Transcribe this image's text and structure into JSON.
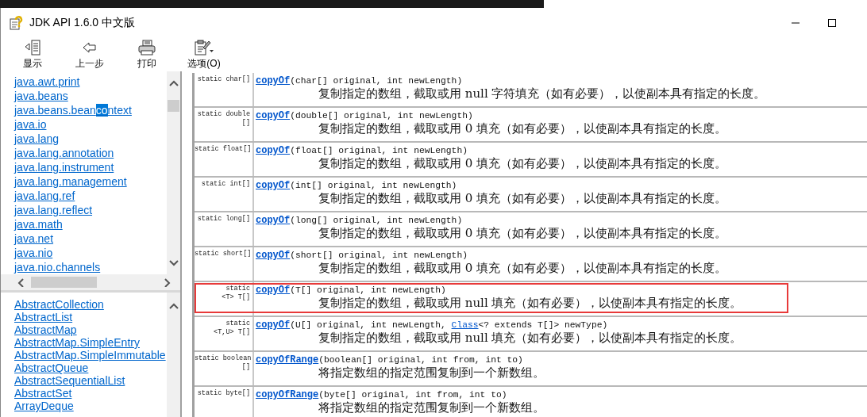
{
  "window": {
    "title": "JDK API 1.6.0 中文版"
  },
  "toolbar": [
    {
      "label": "显示",
      "kind": "show"
    },
    {
      "label": "上一步",
      "kind": "back"
    },
    {
      "label": "打印",
      "kind": "print"
    },
    {
      "label": "选项(O)",
      "kind": "options"
    }
  ],
  "packages": [
    {
      "parts": [
        "java.awt.print"
      ]
    },
    {
      "parts": [
        "java.beans"
      ]
    },
    {
      "parts": [
        "java.beans.bean",
        "co",
        "ntext"
      ]
    },
    {
      "parts": [
        "java.io"
      ]
    },
    {
      "parts": [
        "java.lang"
      ]
    },
    {
      "parts": [
        "java.lang.annotation"
      ]
    },
    {
      "parts": [
        "java.lang.instrument"
      ]
    },
    {
      "parts": [
        "java.lang.management"
      ]
    },
    {
      "parts": [
        "java.lang.ref"
      ]
    },
    {
      "parts": [
        "java.lang.reflect"
      ]
    },
    {
      "parts": [
        "java.math"
      ]
    },
    {
      "parts": [
        "java.net"
      ]
    },
    {
      "parts": [
        "java.nio"
      ]
    },
    {
      "parts": [
        "java.nio.channels"
      ]
    }
  ],
  "classes": [
    "AbstractCollection",
    "AbstractList",
    "AbstractMap",
    "AbstractMap.SimpleEntry",
    "AbstractMap.SimpleImmutable",
    "AbstractQueue",
    "AbstractSequentialList",
    "AbstractSet",
    "ArrayDeque"
  ],
  "methods": [
    {
      "modifier": [
        "static char[]"
      ],
      "name": "copyOf",
      "signature": [
        {
          "kind": "text",
          "text": "(char[] original, int newLength)"
        }
      ],
      "description": "复制指定的数组，截取或用 null 字符填充（如有必要），以使副本具有指定的长度。",
      "highlighted": false
    },
    {
      "modifier": [
        "static double",
        "[]"
      ],
      "name": "copyOf",
      "signature": [
        {
          "kind": "text",
          "text": "(double[] original, int newLength)"
        }
      ],
      "description": "复制指定的数组，截取或用 0 填充（如有必要），以使副本具有指定的长度。",
      "highlighted": false
    },
    {
      "modifier": [
        "static float[]"
      ],
      "name": "copyOf",
      "signature": [
        {
          "kind": "text",
          "text": "(float[] original, int newLength)"
        }
      ],
      "description": "复制指定的数组，截取或用 0 填充（如有必要），以使副本具有指定的长度。",
      "highlighted": false
    },
    {
      "modifier": [
        "static int[]"
      ],
      "name": "copyOf",
      "signature": [
        {
          "kind": "text",
          "text": "(int[] original, int newLength)"
        }
      ],
      "description": "复制指定的数组，截取或用 0 填充（如有必要），以使副本具有指定的长度。",
      "highlighted": false
    },
    {
      "modifier": [
        "static long[]"
      ],
      "name": "copyOf",
      "signature": [
        {
          "kind": "text",
          "text": "(long[] original, int newLength)"
        }
      ],
      "description": "复制指定的数组，截取或用 0 填充（如有必要），以使副本具有指定的长度。",
      "highlighted": false
    },
    {
      "modifier": [
        "static short[]"
      ],
      "name": "copyOf",
      "signature": [
        {
          "kind": "text",
          "text": "(short[] original, int newLength)"
        }
      ],
      "description": "复制指定的数组，截取或用 0 填充（如有必要），以使副本具有指定的长度。",
      "highlighted": false
    },
    {
      "modifier": [
        "static",
        "<T> T[]"
      ],
      "name": "copyOf",
      "signature": [
        {
          "kind": "text",
          "text": "(T[] original, int newLength)"
        }
      ],
      "description": "复制指定的数组，截取或用 null 填充（如有必要），以使副本具有指定的长度。",
      "highlighted": true
    },
    {
      "modifier": [
        "static",
        "<T,U> T[]"
      ],
      "name": "copyOf",
      "signature": [
        {
          "kind": "text",
          "text": "(U[] original, int newLength, "
        },
        {
          "kind": "link",
          "text": "Class"
        },
        {
          "kind": "text",
          "text": "<? extends T[]> newType)"
        }
      ],
      "description": "复制指定的数组，截取或用 null 填充（如有必要），以使副本具有指定的长度。",
      "highlighted": false
    },
    {
      "modifier": [
        "static boolean",
        "[]"
      ],
      "name": "copyOfRange",
      "signature": [
        {
          "kind": "text",
          "text": "(boolean[] original, int from, int to)"
        }
      ],
      "description": "将指定数组的指定范围复制到一个新数组。",
      "highlighted": false
    },
    {
      "modifier": [
        "static byte[]"
      ],
      "name": "copyOfRange",
      "signature": [
        {
          "kind": "text",
          "text": "(byte[] original, int from, int to)"
        }
      ],
      "description": "将指定数组的指定范围复制到一个新数组。",
      "highlighted": false
    }
  ]
}
